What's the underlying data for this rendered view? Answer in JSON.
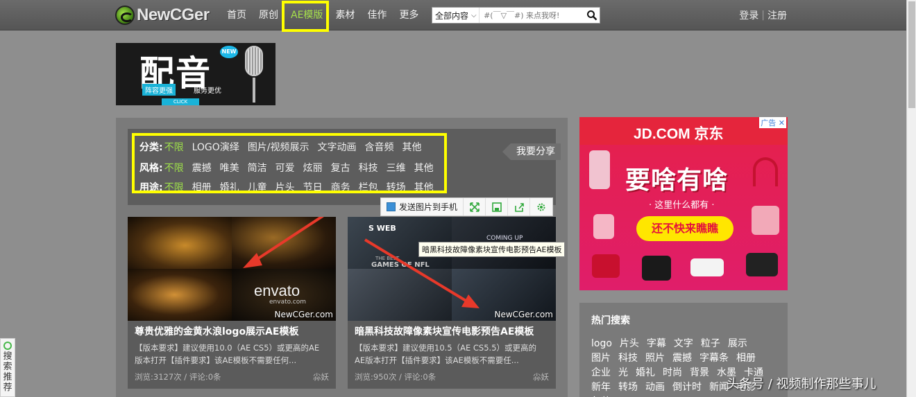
{
  "header": {
    "logo_text": "NewCGer",
    "nav": [
      "首页",
      "原创",
      "AE模版",
      "素材",
      "佳作",
      "更多"
    ],
    "search": {
      "category": "全部内容",
      "placeholder": "#(￣▽￣#) 来点我呀!"
    },
    "login": "登录",
    "register": "注册"
  },
  "banner": {
    "title": "配音",
    "badge": "NEW",
    "tagline_left": "阵容更强",
    "tagline_right": "服务更优",
    "click": "CLICK"
  },
  "filter": {
    "category_label": "分类:",
    "category_options": [
      "不限",
      "LOGO演绎",
      "图片/视频展示",
      "文字动画",
      "含音频",
      "其他"
    ],
    "style_label": "风格:",
    "style_options": [
      "不限",
      "震撼",
      "唯美",
      "简洁",
      "可爱",
      "炫丽",
      "复古",
      "科技",
      "三维",
      "其他"
    ],
    "usage_label": "用途:",
    "usage_options": [
      "不限",
      "相册",
      "婚礼",
      "儿童",
      "片头",
      "节日",
      "商务",
      "栏包",
      "转场",
      "其他"
    ],
    "share_button": "我要分享"
  },
  "image_toolbar": {
    "send_label": "发送图片到手机"
  },
  "cards": [
    {
      "title": "尊贵优雅的金黄水浪logo展示AE模板",
      "desc_line1": "【版本要求】建议使用10.0（AE CS5）或更高的AE",
      "desc_line2": "版本打开【插件要求】该AE模板不需要任何...",
      "meta": "浏览:3127次 / 评论:0条",
      "author": "尛妖",
      "watermark": "NewCGer.com",
      "thumb_text": "envato",
      "thumb_sub": "envato.com"
    },
    {
      "title": "暗黑科技故障像素块宣传电影预告AE模板",
      "desc_line1": "【版本要求】建议使用10.5（AE CS5.5）或更高的",
      "desc_line2": "AE版本打开【插件要求】该AE模板不需要任...",
      "meta": "浏览:950次 / 评论:0条",
      "author": "尛妖",
      "watermark": "NewCGer.com",
      "thumb_text_a": "COMING UP",
      "thumb_text_b": "GAMES OF NFL",
      "thumb_text_c": "S WEB",
      "thumb_text_d": "THE BEST"
    }
  ],
  "tooltip": "暗黑科技故障像素块宣传电影预告AE模板",
  "ad": {
    "logo": "JD.COM 京东",
    "label": "广告",
    "headline": "要啥有啥",
    "sub": "· 这里什么都有 ·",
    "cta": "还不快来瞧瞧"
  },
  "hot_search": {
    "title": "热门搜索",
    "terms": [
      "logo",
      "片头",
      "字幕",
      "文字",
      "粒子",
      "展示",
      "图片",
      "科技",
      "照片",
      "震撼",
      "字幕条",
      "相册",
      "企业",
      "光",
      "婚礼",
      "时尚",
      "背景",
      "水墨",
      "卡通",
      "新年",
      "转场",
      "动画",
      "倒计时",
      "新闻",
      "电影",
      "包装"
    ]
  },
  "side_tab": {
    "text": "搜索推荐"
  },
  "footer_watermark": "头条号 / 视频制作那些事儿",
  "colors": {
    "highlight": "#ffff00",
    "accent_green": "#9ee04a",
    "arrow_red": "#e8392a",
    "jd_red": "#e5253c"
  }
}
